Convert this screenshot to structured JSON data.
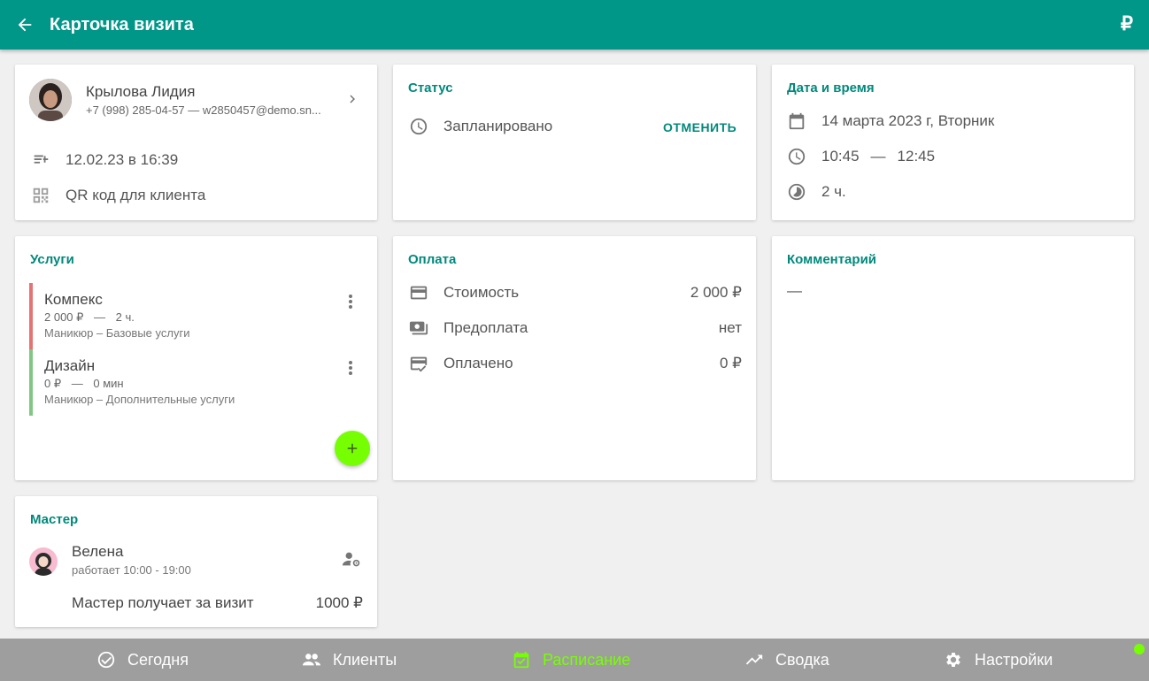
{
  "header": {
    "title": "Карточка визита",
    "currency_symbol": "₽"
  },
  "client": {
    "name": "Крылова Лидия",
    "contact": "+7 (998) 285-04-57 — w2850457@demo.sn...",
    "created": "12.02.23 в 16:39",
    "qr_label": "QR код для клиента"
  },
  "status": {
    "title": "Статус",
    "value": "Запланировано",
    "cancel_label": "ОТМЕНИТЬ"
  },
  "datetime": {
    "title": "Дата и время",
    "date": "14 марта 2023 г, Вторник",
    "start": "10:45",
    "separator": "—",
    "end": "12:45",
    "duration": "2 ч."
  },
  "services": {
    "title": "Услуги",
    "items": [
      {
        "name": "Компекс",
        "price": "2 000 ₽",
        "dash": "—",
        "duration": "2 ч.",
        "category": "Маникюр – Базовые услуги",
        "color": "#e57373"
      },
      {
        "name": "Дизайн",
        "price": "0 ₽",
        "dash": "—",
        "duration": "0 мин",
        "category": "Маникюр – Дополнительные услуги",
        "color": "#81c784"
      }
    ]
  },
  "payment": {
    "title": "Оплата",
    "rows": [
      {
        "label": "Стоимость",
        "value": "2 000 ₽"
      },
      {
        "label": "Предоплата",
        "value": "нет"
      },
      {
        "label": "Оплачено",
        "value": "0 ₽"
      }
    ]
  },
  "comment": {
    "title": "Комментарий",
    "value": "—"
  },
  "master": {
    "title": "Мастер",
    "name": "Велена",
    "hours": "работает 10:00 - 19:00",
    "earns_label": "Мастер получает за визит",
    "earns_value": "1000 ₽"
  },
  "nav": [
    {
      "label": "Сегодня",
      "icon": "check-circle-icon"
    },
    {
      "label": "Клиенты",
      "icon": "people-icon"
    },
    {
      "label": "Расписание",
      "icon": "calendar-check-icon",
      "active": true
    },
    {
      "label": "Сводка",
      "icon": "trending-up-icon"
    },
    {
      "label": "Настройки",
      "icon": "gear-icon"
    }
  ],
  "colors": {
    "primary": "#009688",
    "accent": "#76ff03",
    "title_teal": "#00897b",
    "nav_bg": "#9e9e9e"
  }
}
